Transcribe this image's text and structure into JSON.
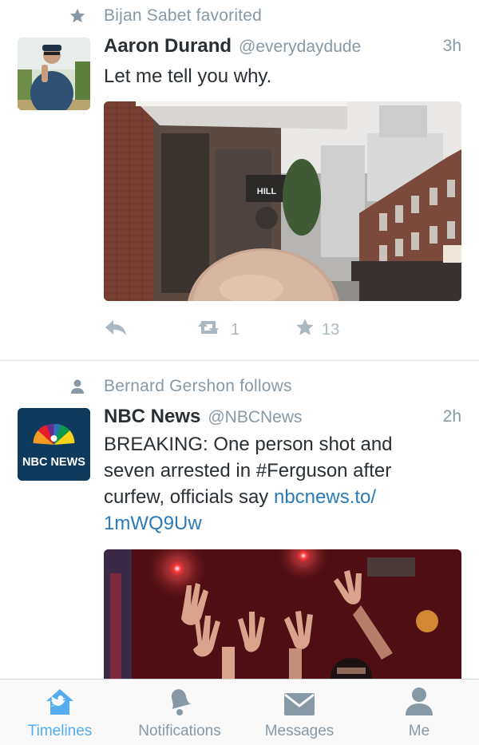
{
  "timeline": {
    "tweets": [
      {
        "context": {
          "icon": "star-icon",
          "text": "Bijan Sabet favorited"
        },
        "author": {
          "name": "Aaron Durand",
          "handle": "@everydaydude"
        },
        "time": "3h",
        "text": "Let me tell you why.",
        "media": "photo of a street with brick buildings and a bald head in the foreground, sign reading HILL",
        "sign_text": "HILL",
        "actions": {
          "reply_icon": "reply-icon",
          "retweet_icon": "retweet-icon",
          "retweets": "1",
          "favorite_icon": "star-icon",
          "favorites": "13"
        }
      },
      {
        "context": {
          "icon": "person-icon",
          "text": "Bernard Gershon follows"
        },
        "author": {
          "name": "NBC News",
          "handle": "@NBCNews",
          "avatar_text": "NBC NEWS"
        },
        "time": "2h",
        "text": "BREAKING: One person shot and seven arrested in #Ferguson after curfew, officials say ",
        "link": "nbcnews.to/\n1mWQ9Uw",
        "media": "photo of protesters raising hands under red lights"
      }
    ]
  },
  "tabbar": {
    "tabs": [
      {
        "label": "Timelines",
        "icon": "home-icon",
        "active": true
      },
      {
        "label": "Notifications",
        "icon": "bell-icon",
        "active": false
      },
      {
        "label": "Messages",
        "icon": "envelope-icon",
        "active": false
      },
      {
        "label": "Me",
        "icon": "person-icon",
        "active": false
      }
    ]
  },
  "colors": {
    "accent": "#55acee",
    "link": "#2b7bb9",
    "muted": "#8899a6",
    "text": "#292f33"
  }
}
